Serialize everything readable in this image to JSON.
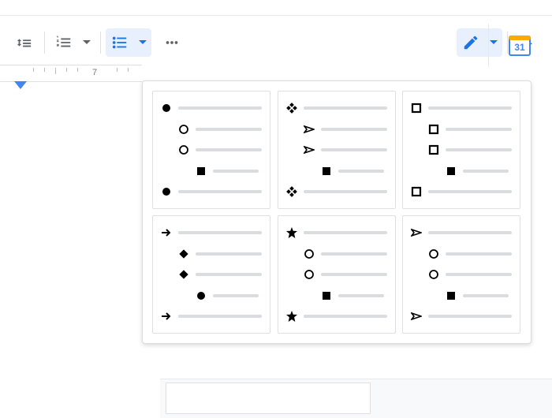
{
  "toolbar": {
    "line_spacing": "line-spacing",
    "numbered_list": "numbered-list",
    "bulleted_list": "bulleted-list",
    "more": "more",
    "edit_mode": "edit",
    "collapse": "collapse"
  },
  "ruler": {
    "number_shown": "7"
  },
  "calendar": {
    "day": "31"
  },
  "presets": [
    {
      "id": "disc-circle-square",
      "levels": [
        "disc",
        "circle",
        "circle",
        "filled-square",
        "disc"
      ]
    },
    {
      "id": "diamond-cluster-arrow",
      "levels": [
        "diamond4",
        "send",
        "send",
        "filled-square",
        "diamond4"
      ]
    },
    {
      "id": "hollow-square-nested",
      "levels": [
        "hollow-square",
        "hollow-square",
        "hollow-square",
        "filled-square",
        "hollow-square"
      ]
    },
    {
      "id": "arrow-diamond-disc",
      "levels": [
        "arrow",
        "diamond",
        "diamond",
        "disc",
        "arrow"
      ]
    },
    {
      "id": "star-circle-square",
      "levels": [
        "star",
        "circle",
        "circle",
        "filled-square",
        "star"
      ]
    },
    {
      "id": "send-circle-square",
      "levels": [
        "send",
        "circle",
        "circle",
        "filled-square",
        "send"
      ]
    }
  ]
}
